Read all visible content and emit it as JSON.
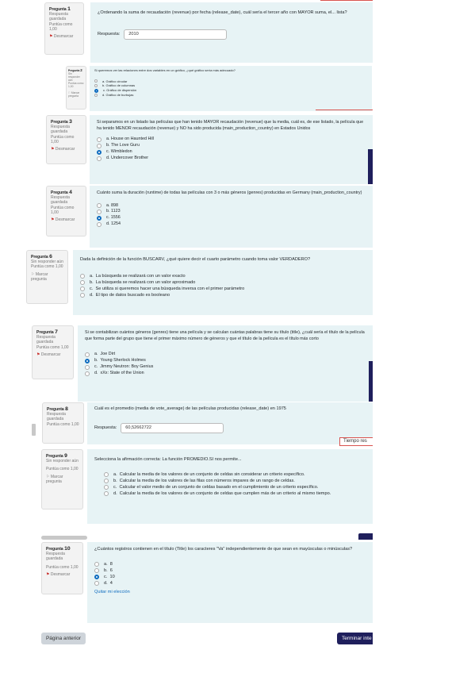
{
  "questions": [
    {
      "title_prefix": "Pregunta",
      "number": "1",
      "status": "Respuesta guardada",
      "grade": "Puntúa como 1,00",
      "flag": "Desmarcar",
      "text": "¿Ordenando la suma de recaudación (revenue) por fecha (release_date), cuál sería el tercer año con MAYOR suma, el... lista?",
      "answer_label": "Respuesta:",
      "answer_value": "2010"
    },
    {
      "title_prefix": "Pregunta",
      "number": "2",
      "status": "Sin responder aún",
      "grade": "Puntúa como 1,00",
      "flag": "Marcar pregunta",
      "text": "Si queremos ver las relaciones entre dos variables en un gráfico, ¿qué gráfico sería más adecuado?",
      "options": [
        {
          "letter": "a.",
          "text": "Gráfico circular",
          "selected": false
        },
        {
          "letter": "b.",
          "text": "Gráfico de columnas",
          "selected": false
        },
        {
          "letter": "c.",
          "text": "Gráfico de dispersión",
          "selected": true
        },
        {
          "letter": "d.",
          "text": "Gráfico de burbujas",
          "selected": false
        }
      ]
    },
    {
      "title_prefix": "Pregunta",
      "number": "3",
      "status": "Respuesta guardada",
      "grade": "Puntúa como 1,00",
      "flag": "Desmarcar",
      "text": "Si separamos en un listado las películas que han tenido MAYOR recaudación (revenue) que la media, cuál es, de ese listado, la película que ha tenido MENOR recaudación (revenue) y NO ha sido producida (main_production_country) en Estados Unidos",
      "options": [
        {
          "letter": "a.",
          "text": "House on Haunted Hill",
          "selected": false
        },
        {
          "letter": "b.",
          "text": "The Love Guru",
          "selected": false
        },
        {
          "letter": "c.",
          "text": "Wimbledon",
          "selected": true
        },
        {
          "letter": "d.",
          "text": "Undercover Brother",
          "selected": false
        }
      ]
    },
    {
      "title_prefix": "Pregunta",
      "number": "4",
      "status": "Respuesta guardada",
      "grade": "Puntúa como 1,00",
      "flag": "Desmarcar",
      "text": "Cuánto suma la duración (runtime) de todas las películas con 3 o más géneros (genres) producidas en Germany (main_production_country)",
      "options": [
        {
          "letter": "a.",
          "text": "898",
          "selected": false
        },
        {
          "letter": "b.",
          "text": "1123",
          "selected": false
        },
        {
          "letter": "c.",
          "text": "1556",
          "selected": true
        },
        {
          "letter": "d.",
          "text": "1254",
          "selected": false
        }
      ]
    },
    {
      "title_prefix": "Pregunta",
      "number": "6",
      "status": "Sin responder aún",
      "grade": "Puntúa como 1,00",
      "flag": "Marcar pregunta",
      "text": "Dada la definición de la función BUSCARV, ¿qué quiere decir el cuarto parámetro cuando toma valor VERDADERO?",
      "options": [
        {
          "letter": "a.",
          "text": "La búsqueda se realizará con un valor exacto",
          "selected": false
        },
        {
          "letter": "b.",
          "text": "La búsqueda se realizará con un valor aproximado",
          "selected": false
        },
        {
          "letter": "c.",
          "text": "Se utiliza si queremos hacer una búsqueda inversa con el primer parámetro",
          "selected": false
        },
        {
          "letter": "d.",
          "text": "El tipo de datos buscado es booleano",
          "selected": false
        }
      ]
    },
    {
      "title_prefix": "Pregunta",
      "number": "7",
      "status": "Respuesta guardada",
      "grade": "Puntúa como 1,00",
      "flag": "Desmarcar",
      "text": "Si se contabilizan cuántos géneros (genres) tiene una película y se calculan cuántas palabras tiene su título (title), ¿cuál sería el título de la película que forma parte del grupo que tiene el primer máximo número de géneros y que el título de la película es el título más corto",
      "options": [
        {
          "letter": "a.",
          "text": "Joe Dirt",
          "selected": false
        },
        {
          "letter": "b.",
          "text": "Young Sherlock Holmes",
          "selected": true
        },
        {
          "letter": "c.",
          "text": "Jimmy Neutron: Boy Genius",
          "selected": false
        },
        {
          "letter": "d.",
          "text": "xXx: State of the Union",
          "selected": false
        }
      ]
    },
    {
      "title_prefix": "Pregunta",
      "number": "8",
      "status": "Respuesta guardada",
      "grade": "Puntúa como 1,00",
      "flag": "",
      "text": "Cuál es el promedio (media de vote_average) de las películas producidas (release_date) en 1975",
      "answer_label": "Respuesta:",
      "answer_value": "60,52662722"
    },
    {
      "title_prefix": "Pregunta",
      "number": "9",
      "status": "Sin responder aún",
      "grade": "Puntúa como 1,00",
      "flag": "Marcar pregunta",
      "text": "Selecciona la afirmación correcta: La función PROMEDIO.SI nos permite...",
      "options": [
        {
          "letter": "a.",
          "text": "Calcular la media de los valores de un conjunto de celdas sin considerar un criterio específico.",
          "selected": false
        },
        {
          "letter": "b.",
          "text": "Calcular la media de los valores de las filas con números impares de un rango de celdas.",
          "selected": false
        },
        {
          "letter": "c.",
          "text": "Calcular el valor medio de un conjunto de celdas basado en el cumplimiento de un criterio específico.",
          "selected": false
        },
        {
          "letter": "d.",
          "text": "Calcular la media de los valores de un conjunto de celdas que cumplen más de un criterio al mismo tiempo.",
          "selected": false
        }
      ]
    },
    {
      "title_prefix": "Pregunta",
      "number": "10",
      "status": "Respuesta guardada",
      "grade": "Puntúa como 1,00",
      "flag": "Desmarcar",
      "text": "¿Cuántos registros contienen en el título (Title) los caracteres \"Va\" independientemente de que sean en mayúsculas o minúsculas?",
      "options": [
        {
          "letter": "a.",
          "text": "8",
          "selected": false
        },
        {
          "letter": "b.",
          "text": "6",
          "selected": false
        },
        {
          "letter": "c.",
          "text": "10",
          "selected": true
        },
        {
          "letter": "d.",
          "text": "4",
          "selected": false
        }
      ],
      "clear_choice": "Quitar mi elección"
    }
  ],
  "timer_label": "Tiempo res",
  "footer": {
    "prev_label": "Página anterior",
    "next_label": "Terminar inte"
  },
  "colors": {
    "content_bg": "#e7f3f5",
    "accent_navy": "#1f1f5c",
    "flag_red": "#c9302c",
    "radio_selected": "#0f6cbf"
  }
}
